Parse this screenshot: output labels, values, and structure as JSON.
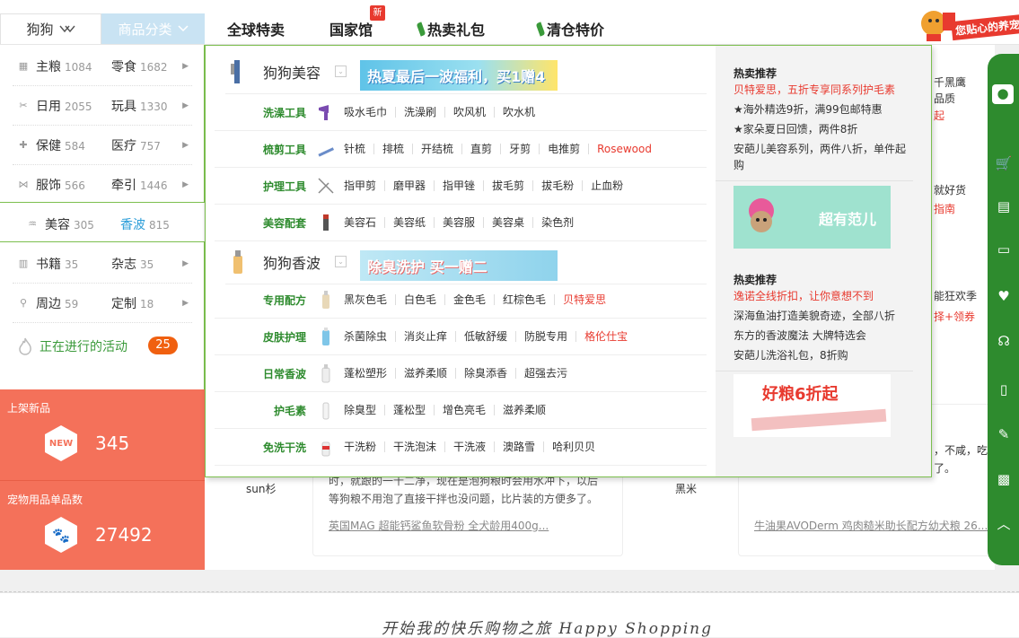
{
  "header": {
    "pet_selector": "狗狗",
    "category_selector": "商品分类",
    "nav": [
      {
        "label": "全球特卖"
      },
      {
        "label": "国家馆",
        "badge": "新"
      },
      {
        "label": "热卖礼包"
      },
      {
        "label": "清仓特价"
      }
    ],
    "promo_text": "您贴心的养宠"
  },
  "sidebar": {
    "rows": [
      [
        {
          "label": "主粮",
          "count": "1084"
        },
        {
          "label": "零食",
          "count": "1682"
        }
      ],
      [
        {
          "label": "日用",
          "count": "2055"
        },
        {
          "label": "玩具",
          "count": "1330"
        }
      ],
      [
        {
          "label": "保健",
          "count": "584"
        },
        {
          "label": "医疗",
          "count": "757"
        }
      ],
      [
        {
          "label": "服饰",
          "count": "566"
        },
        {
          "label": "牵引",
          "count": "1446"
        }
      ],
      [
        {
          "label": "美容",
          "count": "305"
        },
        {
          "label": "香波",
          "count": "815"
        }
      ],
      [
        {
          "label": "书籍",
          "count": "35"
        },
        {
          "label": "杂志",
          "count": "35"
        }
      ],
      [
        {
          "label": "周边",
          "count": "59"
        },
        {
          "label": "定制",
          "count": "18"
        }
      ]
    ],
    "activity": {
      "label": "正在进行的活动",
      "count": "25"
    },
    "stats": [
      {
        "title": "上架新品",
        "badge": "NEW",
        "value": "345"
      },
      {
        "title": "宠物用品单品数",
        "value": "27492"
      }
    ]
  },
  "mega_menu": {
    "sections": [
      {
        "title": "狗狗美容",
        "banner": "热夏最后一波福利，买1赠4",
        "rows": [
          {
            "title": "洗澡工具",
            "items": [
              "吸水毛巾",
              "洗澡刷",
              "吹风机",
              "吹水机"
            ]
          },
          {
            "title": "梳剪工具",
            "items": [
              "针梳",
              "排梳",
              "开结梳",
              "直剪",
              "牙剪",
              "电推剪",
              "Rosewood"
            ]
          },
          {
            "title": "护理工具",
            "items": [
              "指甲剪",
              "磨甲器",
              "指甲锉",
              "拔毛剪",
              "拔毛粉",
              "止血粉"
            ]
          },
          {
            "title": "美容配套",
            "items": [
              "美容石",
              "美容纸",
              "美容服",
              "美容桌",
              "染色剂"
            ]
          }
        ]
      },
      {
        "title": "狗狗香波",
        "banner": "除臭洗护 买一赠二",
        "rows": [
          {
            "title": "专用配方",
            "items": [
              "黑灰色毛",
              "白色毛",
              "金色毛",
              "红棕色毛",
              "贝特爱思"
            ]
          },
          {
            "title": "皮肤护理",
            "items": [
              "杀菌除虫",
              "消炎止痒",
              "低敏舒缓",
              "防脱专用",
              "格伦仕宝"
            ]
          },
          {
            "title": "日常香波",
            "items": [
              "蓬松塑形",
              "滋养柔顺",
              "除臭添香",
              "超强去污"
            ]
          },
          {
            "title": "护毛素",
            "items": [
              "除臭型",
              "蓬松型",
              "增色亮毛",
              "滋养柔顺"
            ]
          },
          {
            "title": "免洗干洗",
            "items": [
              "干洗粉",
              "干洗泡沫",
              "干洗液",
              "澳路雪",
              "哈利贝贝"
            ]
          }
        ]
      }
    ],
    "recommend": [
      {
        "heading": "热卖推荐",
        "highlight": "贝特爱思，五折专享同系列护毛素",
        "lines": [
          "★海外精选9折，满99包邮特惠",
          "★家朵夏日回馈，两件8折",
          "安葩儿美容系列，两件八折，单件起购"
        ],
        "banner": "超有范儿"
      },
      {
        "heading": "热卖推荐",
        "highlight": "逸诺全线折扣，让你意想不到",
        "lines": [
          "深海鱼油打造美貌奇迹，全部八折",
          "东方的香波魔法 大牌特选会",
          "安葩儿洗浴礼包，8折购"
        ],
        "banner": "好粮6折起"
      }
    ]
  },
  "background": {
    "snippets": [
      "千黑鹰",
      "品质",
      "起",
      "就好货",
      "指南",
      "能狂欢季",
      "择+领券",
      "，不咸，吃",
      "了。",
      "sun杉",
      "黑米"
    ],
    "review_text": [
      "时，就跟的一十二净，现在是泡狗粮时会用水冲下，以后",
      "等狗粮不用泡了直接干拌也没问题，比片装的方便多了。"
    ],
    "links": [
      "英国MAG 超能钙鲨鱼软骨粉 全犬龄用400g...",
      "牛油果AVODerm 鸡肉糙米助长配方幼犬粮 26..."
    ]
  },
  "footer": {
    "slogan": "开始我的快乐购物之旅 Happy Shopping"
  },
  "colors": {
    "green": "#2e8b2e",
    "red": "#e83a2f",
    "coral": "#f4715a",
    "blue": "#2a9dd8",
    "orange": "#f06010"
  }
}
